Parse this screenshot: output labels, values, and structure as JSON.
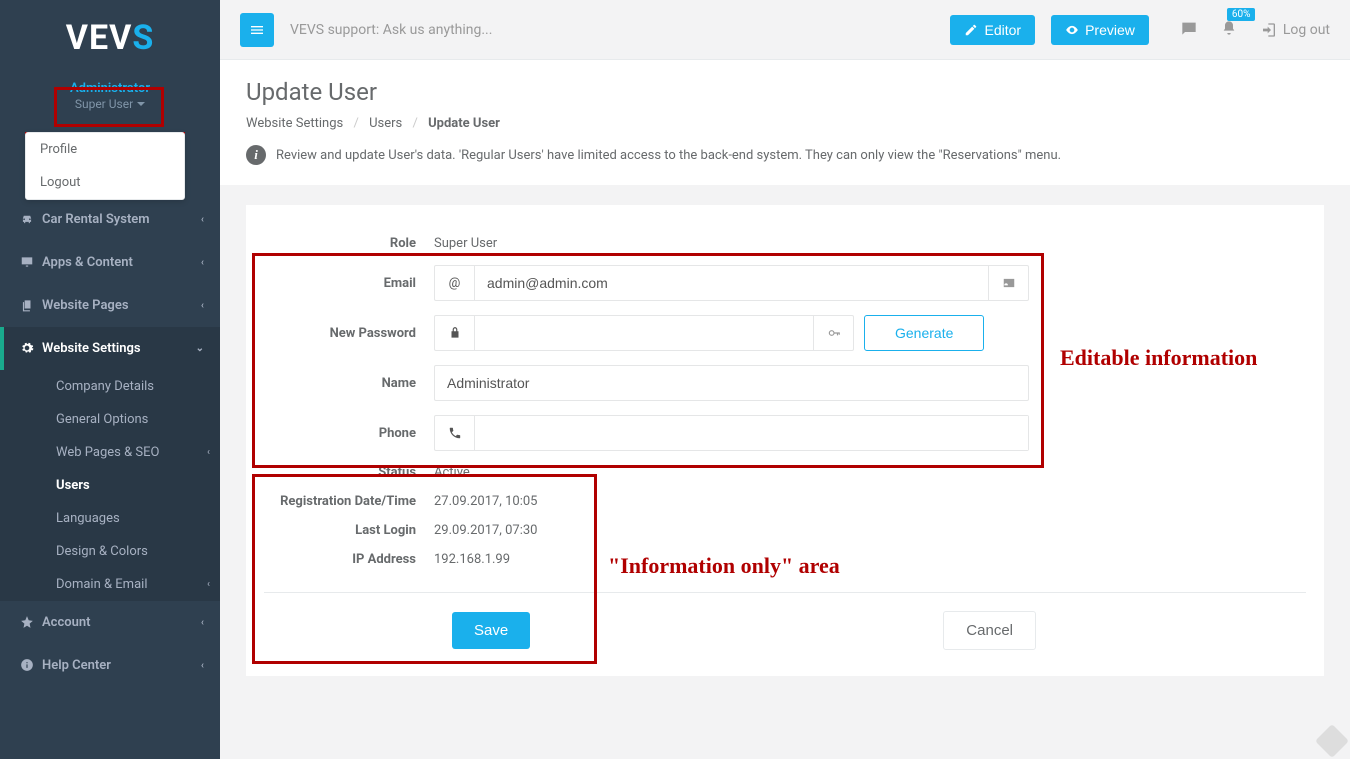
{
  "brand": {
    "part1": "VEV",
    "part2": "S"
  },
  "user": {
    "name": "Administrator",
    "role": "Super User",
    "menu": {
      "profile": "Profile",
      "logout": "Logout"
    }
  },
  "topbar": {
    "support": "VEVS support: Ask us anything...",
    "editor": "Editor",
    "preview": "Preview",
    "progress": "60%",
    "logout": "Log out"
  },
  "nav": {
    "car_rental": "Car Rental System",
    "apps_content": "Apps & Content",
    "website_pages": "Website Pages",
    "website_settings": "Website Settings",
    "account": "Account",
    "help_center": "Help Center",
    "settings_children": {
      "company_details": "Company Details",
      "general_options": "General Options",
      "web_pages_seo": "Web Pages & SEO",
      "users": "Users",
      "languages": "Languages",
      "design_colors": "Design & Colors",
      "domain_email": "Domain & Email"
    }
  },
  "page": {
    "title": "Update User",
    "crumb1": "Website Settings",
    "crumb2": "Users",
    "crumb3": "Update User",
    "help": "Review and update User's data. 'Regular Users' have limited access to the back-end system. They can only view the \"Reservations\" menu."
  },
  "form": {
    "labels": {
      "role": "Role",
      "email": "Email",
      "new_password": "New Password",
      "name": "Name",
      "phone": "Phone",
      "status": "Status",
      "reg_dt": "Registration Date/Time",
      "last_login": "Last Login",
      "ip": "IP Address"
    },
    "values": {
      "role": "Super User",
      "email": "admin@admin.com",
      "password": "",
      "name": "Administrator",
      "phone": "",
      "status": "Active",
      "reg_dt": "27.09.2017, 10:05",
      "last_login": "29.09.2017, 07:30",
      "ip": "192.168.1.99"
    },
    "buttons": {
      "generate": "Generate",
      "save": "Save",
      "cancel": "Cancel"
    }
  },
  "annotations": {
    "editable": "Editable information",
    "info_only": "\"Information only\" area"
  }
}
